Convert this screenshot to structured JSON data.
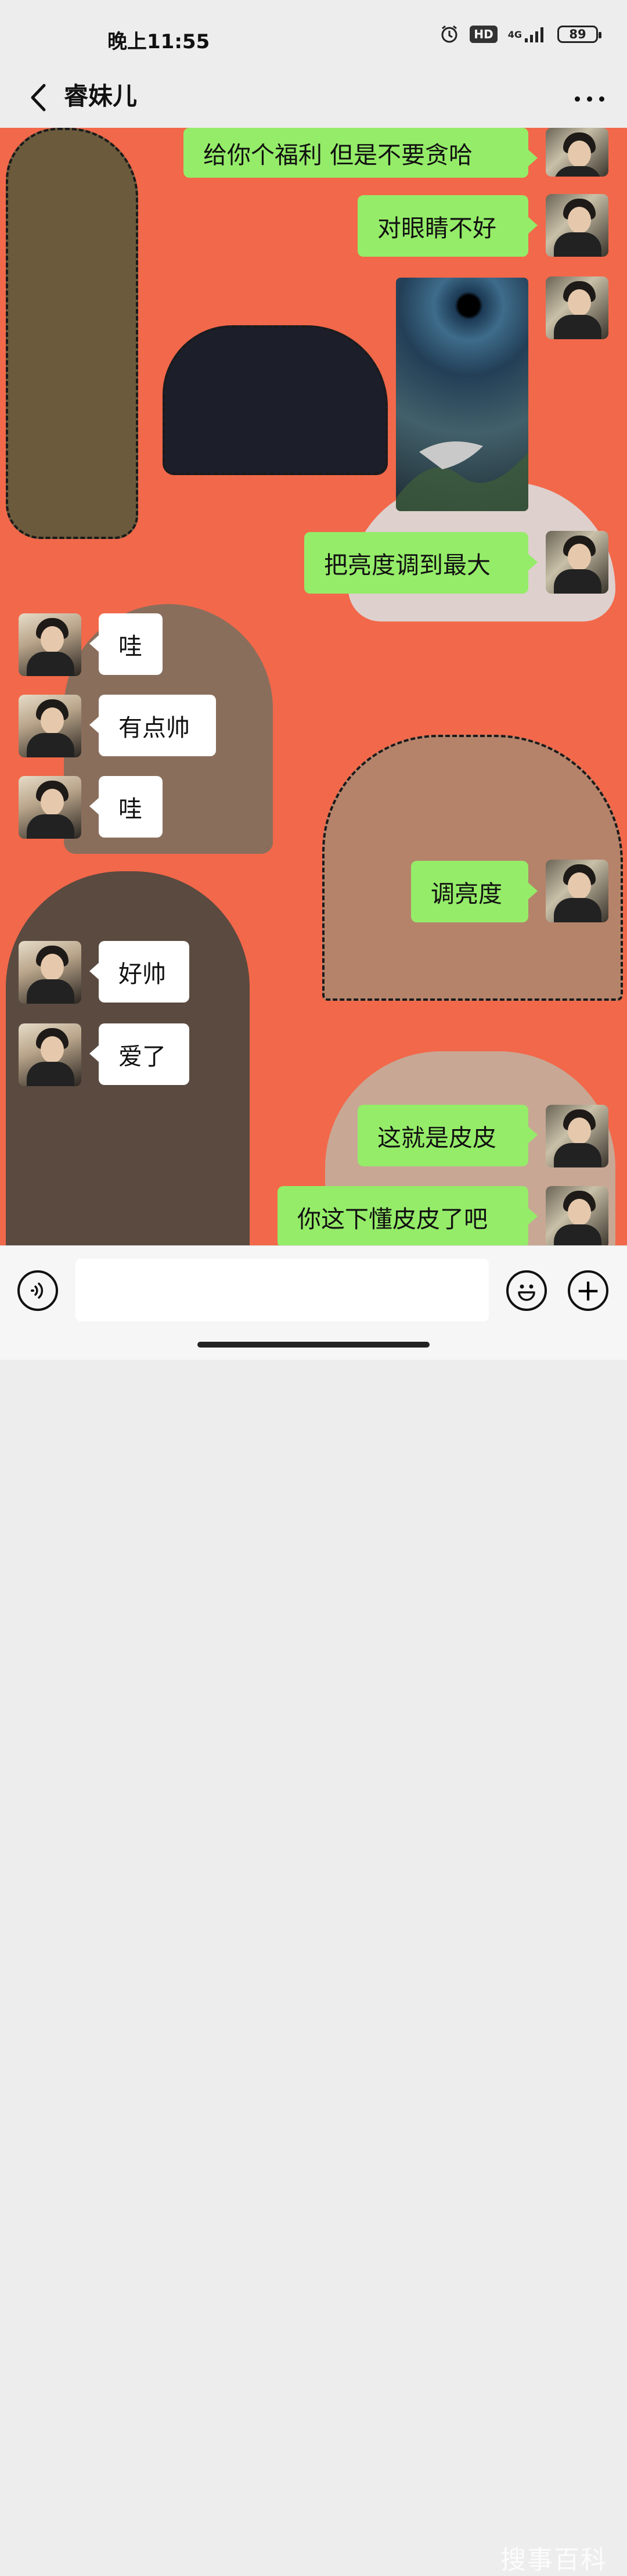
{
  "status_bar": {
    "time": "晚上11:55",
    "hd_label": "HD",
    "network_label": "4G",
    "battery_level": "89",
    "icons": [
      "alarm-icon",
      "hd-icon",
      "4g-signal-icon",
      "battery-icon"
    ]
  },
  "header": {
    "title": "睿妹儿",
    "back_icon": "chevron-left-icon",
    "more_icon": "more-dots-icon"
  },
  "messages": [
    {
      "sender": "me",
      "text": "给你个福利  但是不要贪哈"
    },
    {
      "sender": "me",
      "text": "对眼睛不好"
    },
    {
      "sender": "me",
      "type": "image",
      "text": ""
    },
    {
      "sender": "me",
      "text": "把亮度调到最大"
    },
    {
      "sender": "them",
      "text": "哇"
    },
    {
      "sender": "them",
      "text": "有点帅"
    },
    {
      "sender": "them",
      "text": "哇"
    },
    {
      "sender": "me",
      "text": "调亮度"
    },
    {
      "sender": "them",
      "text": "好帅"
    },
    {
      "sender": "them",
      "text": "爱了"
    },
    {
      "sender": "me",
      "text": "这就是皮皮"
    },
    {
      "sender": "me",
      "text": "你这下懂皮皮了吧"
    }
  ],
  "input_bar": {
    "placeholder": "",
    "voice_icon": "voice-icon",
    "emoji_icon": "emoji-icon",
    "plus_icon": "plus-icon",
    "plus_glyph": "+"
  },
  "watermark": "搜事百科",
  "colors": {
    "chat_background": "#f2684a",
    "outgoing_bubble": "#95ec69",
    "incoming_bubble": "#ffffff",
    "bar_background": "#ededed"
  }
}
